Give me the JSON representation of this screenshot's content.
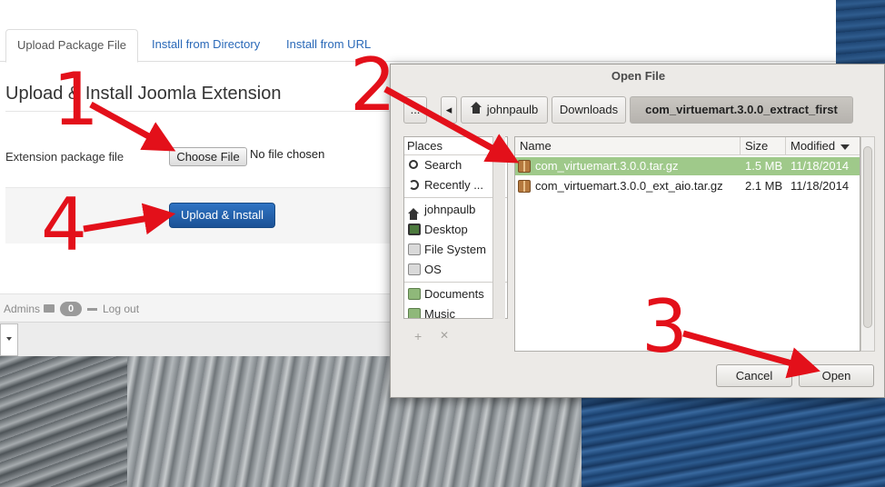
{
  "tabs": [
    {
      "label": "Upload Package File"
    },
    {
      "label": "Install from Directory"
    },
    {
      "label": "Install from URL"
    }
  ],
  "page": {
    "title": "Upload & Install Joomla Extension",
    "field_label": "Extension package file",
    "choose_button": "Choose File",
    "no_file": "No file chosen",
    "upload_button": "Upload & Install"
  },
  "footer": {
    "admins_label": "Admins",
    "message_count": "0",
    "logout_label": "Log out"
  },
  "dialog": {
    "title": "Open File",
    "path": {
      "more_button": "...",
      "back_arrow": "◂",
      "segments": [
        "johnpaulb",
        "Downloads",
        "com_virtuemart.3.0.0_extract_first"
      ]
    },
    "places_header": "Places",
    "places": [
      {
        "label": "Search",
        "icon": "search-icon"
      },
      {
        "label": "Recently ...",
        "icon": "recent-icon"
      },
      {
        "label": "johnpaulb",
        "icon": "home-icon"
      },
      {
        "label": "Desktop",
        "icon": "desktop-icon"
      },
      {
        "label": "File System",
        "icon": "drive-icon"
      },
      {
        "label": "OS",
        "icon": "drive-icon"
      },
      {
        "label": "Documents",
        "icon": "folder-icon"
      },
      {
        "label": "Music",
        "icon": "folder-icon"
      }
    ],
    "add_symbol": "+",
    "remove_symbol": "✕",
    "columns": {
      "name": "Name",
      "size": "Size",
      "modified": "Modified"
    },
    "files": [
      {
        "name": "com_virtuemart.3.0.0.tar.gz",
        "size": "1.5 MB",
        "modified": "11/18/2014",
        "selected": true
      },
      {
        "name": "com_virtuemart.3.0.0_ext_aio.tar.gz",
        "size": "2.1 MB",
        "modified": "11/18/2014",
        "selected": false
      }
    ],
    "cancel_button": "Cancel",
    "open_button": "Open"
  },
  "annotations": [
    "1",
    "2",
    "3",
    "4"
  ],
  "colors": {
    "annotation": "#e3101a",
    "primary_button": "#1c5296",
    "link": "#2a69b8",
    "selection": "#9fc98a"
  }
}
